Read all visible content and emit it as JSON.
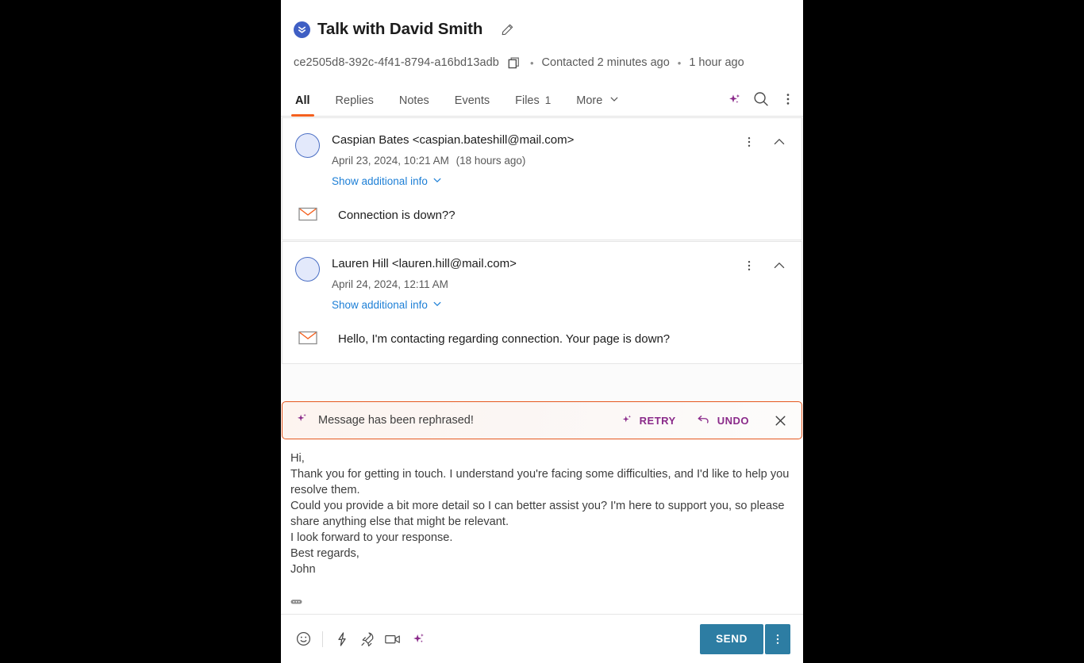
{
  "header": {
    "status_icon": "chevrons-down-circle-icon",
    "status_color": "#3f5fc4",
    "title": "Talk with David Smith",
    "edit_icon": "pencil-icon",
    "conversation_id": "ce2505d8-392c-4f41-8794-a16bd13adb",
    "copy_icon": "copy-icon",
    "separator": "•",
    "contacted_text": "Contacted 2 minutes ago",
    "updated_text": "1 hour ago"
  },
  "tabs": {
    "items": [
      {
        "label": "All",
        "count": "",
        "active": true
      },
      {
        "label": "Replies",
        "count": "",
        "active": false
      },
      {
        "label": "Notes",
        "count": "",
        "active": false
      },
      {
        "label": "Events",
        "count": "",
        "active": false
      },
      {
        "label": "Files",
        "count": "1",
        "active": false
      },
      {
        "label": "More",
        "count": "",
        "active": false
      }
    ],
    "active_underline_color": "#f4601e",
    "actions": [
      {
        "icon": "sparkle-ai-icon",
        "color": "#8a2a8a"
      },
      {
        "icon": "search-icon",
        "color": "#4a4a4a"
      },
      {
        "icon": "overflow-menu-icon",
        "color": "#4a4a4a"
      }
    ]
  },
  "messages": [
    {
      "from": "Caspian Bates <caspian.bateshill@mail.com>",
      "date": "April 23, 2024, 10:21 AM",
      "relative": "(18 hours ago)",
      "show_more_label": "Show additional info",
      "channel_icon": "email-envelope-icon",
      "text": "Connection is down??"
    },
    {
      "from": "Lauren Hill <lauren.hill@mail.com>",
      "date": "April 24, 2024, 12:11 AM",
      "relative": "",
      "show_more_label": "Show additional info",
      "channel_icon": "email-envelope-icon",
      "text": "Hello, I'm contacting regarding connection. Your page is down?"
    }
  ],
  "banner": {
    "icon": "sparkle-ai-icon",
    "message": "Message has been rephrased!",
    "retry_label": "RETRY",
    "retry_icon": "sparkle-ai-icon",
    "undo_label": "UNDO",
    "undo_icon": "undo-arrow-icon",
    "close_icon": "close-icon",
    "border_color": "#e5581f",
    "accent_color": "#8a2a8a"
  },
  "editor": {
    "lines": [
      "Hi,",
      "Thank you for getting in touch. I understand you're facing some difficulties, and I'd like to help you resolve them.",
      "Could you provide a bit more detail so I can better assist you? I'm here to support you, so please share anything else that might be relevant.",
      "I look forward to your response.",
      "Best regards,",
      "John"
    ],
    "ellipsis_icon": "ellipsis-icon"
  },
  "toolbar": {
    "tools": [
      {
        "icon": "emoji-smiley-icon"
      },
      {
        "icon": "lightning-bolt-icon"
      },
      {
        "icon": "rocket-icon"
      },
      {
        "icon": "video-camera-icon"
      },
      {
        "icon": "sparkle-ai-icon"
      }
    ],
    "send_label": "SEND",
    "send_color": "#2d7da3",
    "send_menu_icon": "overflow-menu-icon"
  }
}
